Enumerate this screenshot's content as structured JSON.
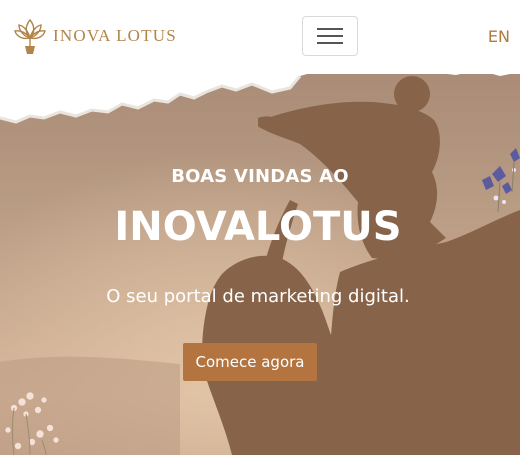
{
  "navbar": {
    "brand_name": "INOVA LOTUS",
    "brand_logo_icon": "lotus-icon",
    "menu_icon": "hamburger-icon",
    "language": "EN"
  },
  "hero": {
    "kicker": "BOAS VINDAS AO",
    "title": "INOVALOTUS",
    "subtitle": "O seu portal de marketing digital.",
    "cta_label": "Comece agora"
  },
  "colors": {
    "brand_gold": "#b28449",
    "cta_background": "#b37440",
    "hero_text": "#ffffff"
  }
}
